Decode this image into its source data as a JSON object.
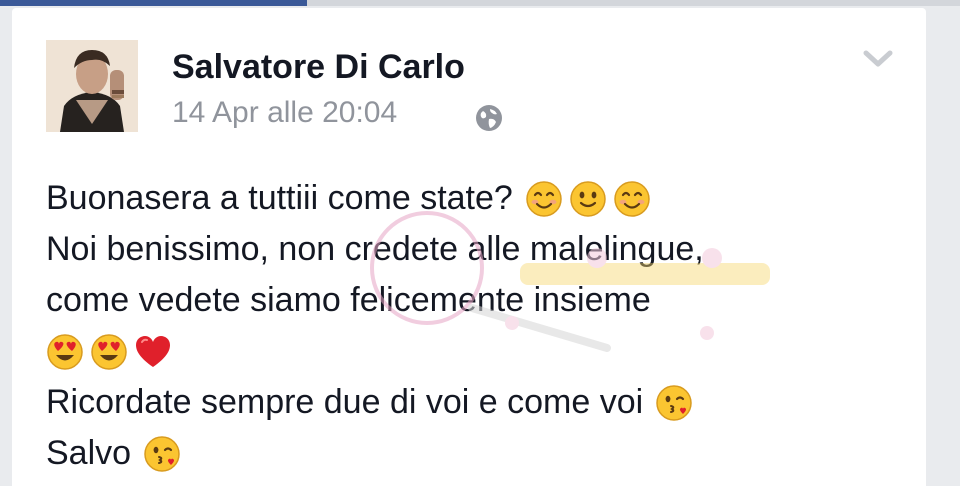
{
  "post": {
    "author_name": "Salvatore Di Carlo",
    "timestamp": "14 Apr alle 20:04",
    "privacy_icon": "globe-icon",
    "menu_icon": "chevron-down-icon",
    "lines": [
      {
        "text": "Buonasera a tuttiii come state?",
        "emojis": [
          "smiling-face-icon",
          "slightly-smiling-face-icon",
          "smiling-face-icon"
        ]
      },
      {
        "text": "Noi benissimo, non credete alle malelingue,",
        "emojis": []
      },
      {
        "text": "come vedete siamo felicemente insieme",
        "emojis": []
      },
      {
        "text": "",
        "emojis": [
          "heart-eyes-icon",
          "heart-eyes-icon",
          "red-heart-icon"
        ]
      },
      {
        "text": "Ricordate sempre due di voi e  come voi",
        "emojis": [
          "face-blowing-kiss-icon"
        ]
      },
      {
        "text": "Salvo",
        "emojis": [
          "face-blowing-kiss-icon"
        ]
      }
    ]
  },
  "colors": {
    "facebook_blue": "#3b5998",
    "text": "#141823",
    "meta_gray": "#90949c",
    "emoji_yellow": "#fbc531",
    "heart_red": "#e0202b"
  }
}
